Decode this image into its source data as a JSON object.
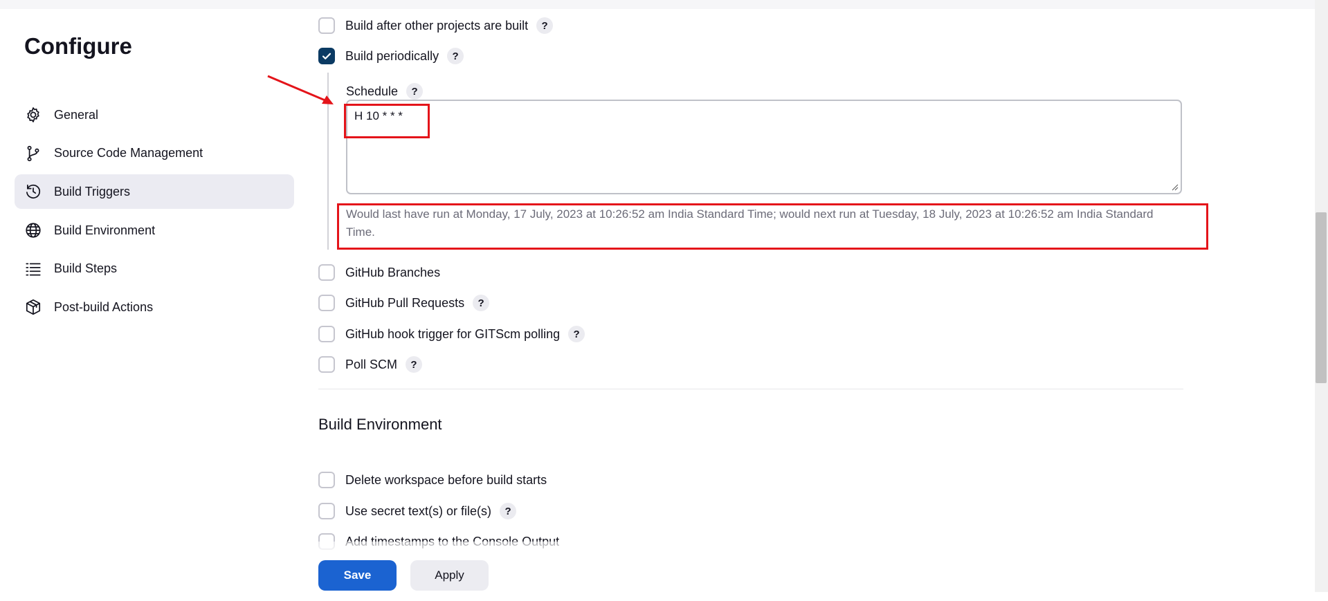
{
  "sidebar": {
    "title": "Configure",
    "items": [
      {
        "label": "General",
        "icon": "gear-icon"
      },
      {
        "label": "Source Code Management",
        "icon": "branch-icon"
      },
      {
        "label": "Build Triggers",
        "icon": "clock-icon",
        "active": true
      },
      {
        "label": "Build Environment",
        "icon": "globe-icon"
      },
      {
        "label": "Build Steps",
        "icon": "list-icon"
      },
      {
        "label": "Post-build Actions",
        "icon": "package-icon"
      }
    ]
  },
  "triggers": {
    "build_after_other": {
      "label": "Build after other projects are built",
      "checked": false
    },
    "build_periodically": {
      "label": "Build periodically",
      "checked": true
    },
    "schedule": {
      "label": "Schedule",
      "value": "H 10 * * *",
      "help_text": "Would last have run at Monday, 17 July, 2023 at 10:26:52 am India Standard Time; would next run at Tuesday, 18 July, 2023 at 10:26:52 am India Standard Time."
    },
    "github_branches": {
      "label": "GitHub Branches",
      "checked": false
    },
    "github_pull_requests": {
      "label": "GitHub Pull Requests",
      "checked": false
    },
    "github_hook": {
      "label": "GitHub hook trigger for GITScm polling",
      "checked": false
    },
    "poll_scm": {
      "label": "Poll SCM",
      "checked": false
    }
  },
  "build_environment": {
    "title": "Build Environment",
    "delete_workspace": {
      "label": "Delete workspace before build starts",
      "checked": false
    },
    "use_secret": {
      "label": "Use secret text(s) or file(s)",
      "checked": false
    },
    "add_timestamps": {
      "label": "Add timestamps to the Console Output",
      "checked": false
    }
  },
  "help_glyph": "?",
  "actions": {
    "save": "Save",
    "apply": "Apply"
  },
  "colors": {
    "accent": "#1b63d1",
    "checkbox_checked": "#0b3a63",
    "annotation": "#e4141a"
  }
}
